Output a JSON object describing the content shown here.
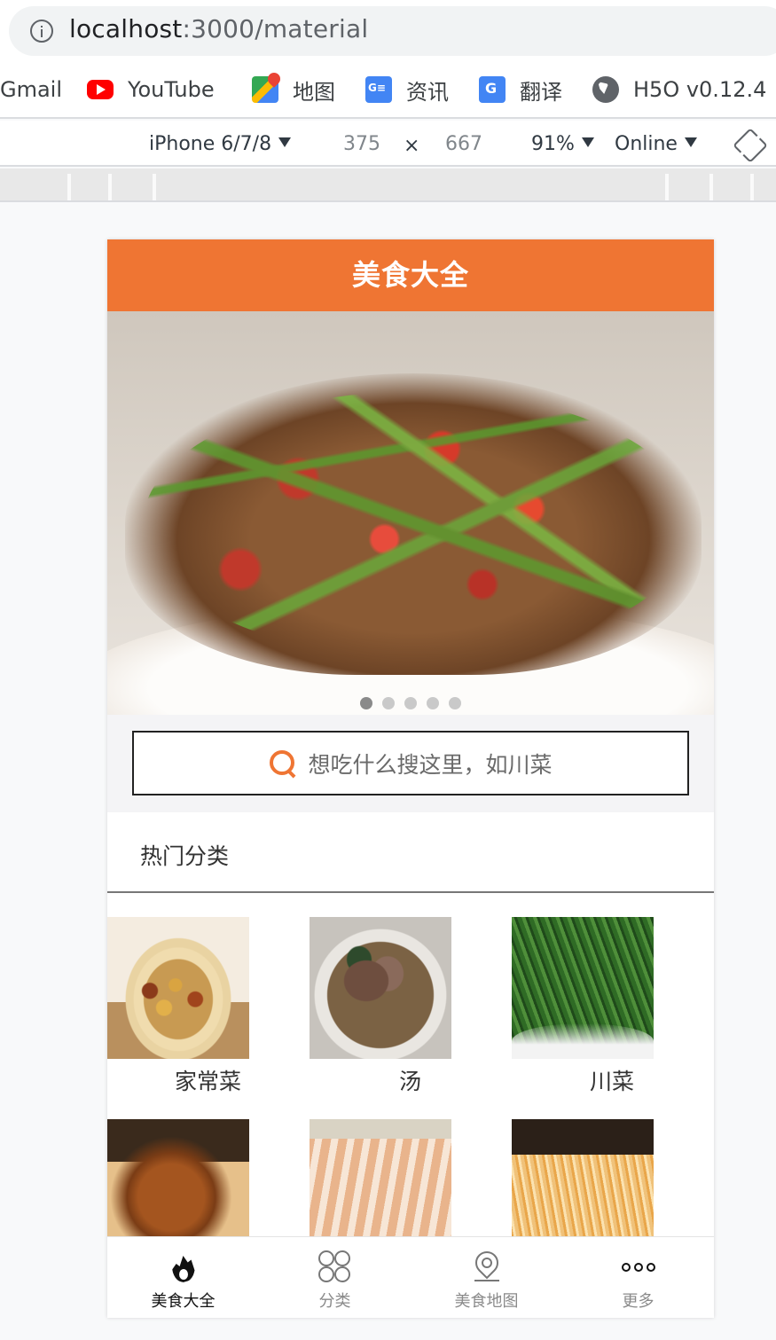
{
  "browser": {
    "url_host": "localhost",
    "url_path": ":3000/material",
    "bookmarks": [
      {
        "label": "Gmail",
        "icon": "gmail-icon"
      },
      {
        "label": "YouTube",
        "icon": "youtube-icon"
      },
      {
        "label": "地图",
        "icon": "maps-icon"
      },
      {
        "label": "资讯",
        "icon": "news-icon"
      },
      {
        "label": "翻译",
        "icon": "translate-icon"
      },
      {
        "label": "H5O v0.12.4",
        "icon": "globe-icon"
      }
    ]
  },
  "devtools": {
    "device": "iPhone 6/7/8",
    "width": "375",
    "times": "×",
    "height": "667",
    "zoom": "91%",
    "network": "Online"
  },
  "app": {
    "title": "美食大全",
    "carousel": {
      "count": 5,
      "active_index": 0
    },
    "search": {
      "placeholder": "想吃什么搜这里，如川菜"
    },
    "section_title": "热门分类",
    "categories": [
      {
        "label": "家常菜"
      },
      {
        "label": "汤"
      },
      {
        "label": "川菜"
      },
      {
        "label": ""
      },
      {
        "label": ""
      },
      {
        "label": ""
      }
    ],
    "tabs": [
      {
        "label": "美食大全",
        "icon": "flame-icon",
        "active": true
      },
      {
        "label": "分类",
        "icon": "grid-icon",
        "active": false
      },
      {
        "label": "美食地图",
        "icon": "map-pin-icon",
        "active": false
      },
      {
        "label": "更多",
        "icon": "more-icon",
        "active": false
      }
    ]
  },
  "colors": {
    "brand_orange": "#ef7533",
    "header_text": "#ffffff"
  }
}
